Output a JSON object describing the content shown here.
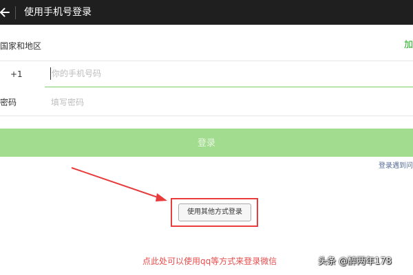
{
  "header": {
    "back_icon": "arrow-left-icon",
    "title": "使用手机号登录"
  },
  "form": {
    "region_label": "国家和地区",
    "region_value": "加",
    "country_code": "+1",
    "phone_placeholder": "你的手机号码",
    "password_label": "密码",
    "password_placeholder": "填写密码"
  },
  "actions": {
    "login_label": "登录",
    "help_link": "登录遇到问",
    "other_login_label": "使用其他方式登录"
  },
  "annotation": {
    "text": "点此处可以使用qq等方式来登录微信"
  },
  "watermark": "头条 @醉两年178",
  "colors": {
    "topbar": "#1f1f1f",
    "accent_green": "#1aad19",
    "login_button_disabled": "#a2dc8f",
    "annotation_red": "#e83b3b",
    "link_blue": "#576b95"
  }
}
